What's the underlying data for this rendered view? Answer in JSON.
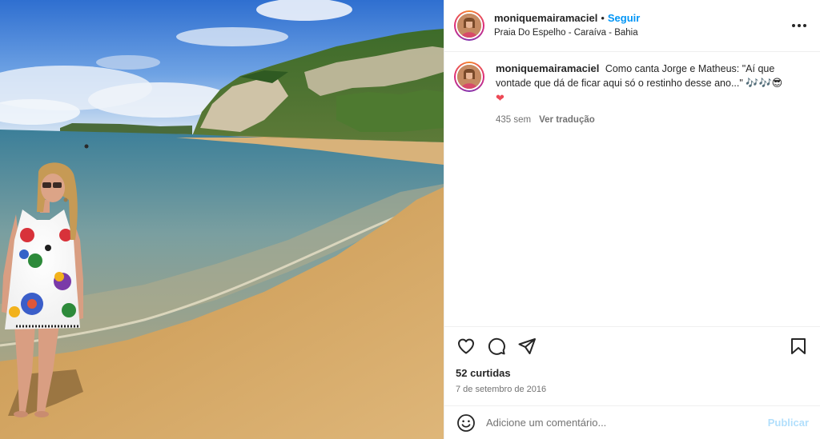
{
  "post": {
    "username": "moniquemairamaciel",
    "separator": "•",
    "follow_label": "Seguir",
    "location": "Praia Do Espelho - Caraíva - Bahia",
    "more_icon": "more-horizontal-icon"
  },
  "caption": {
    "username": "moniquemairamaciel",
    "text": "Como canta Jorge e Matheus: \"Aí que vontade que dá de ficar aqui só o restinho desse ano...\"",
    "emojis": "🎶🎶😎",
    "heart": "❤",
    "age": "435 sem",
    "translate_label": "Ver tradução"
  },
  "actions": {
    "like_icon": "heart-icon",
    "comment_icon": "comment-icon",
    "share_icon": "send-icon",
    "save_icon": "bookmark-icon"
  },
  "likes": "52 curtidas",
  "date": "7 de setembro de 2016",
  "comment_box": {
    "placeholder": "Adicione um comentário...",
    "publish_label": "Publicar",
    "emoji_icon": "smiley-icon"
  },
  "colors": {
    "link_blue": "#0095f6",
    "publish_disabled": "#b2dffc",
    "heart_red": "#ed4956"
  }
}
